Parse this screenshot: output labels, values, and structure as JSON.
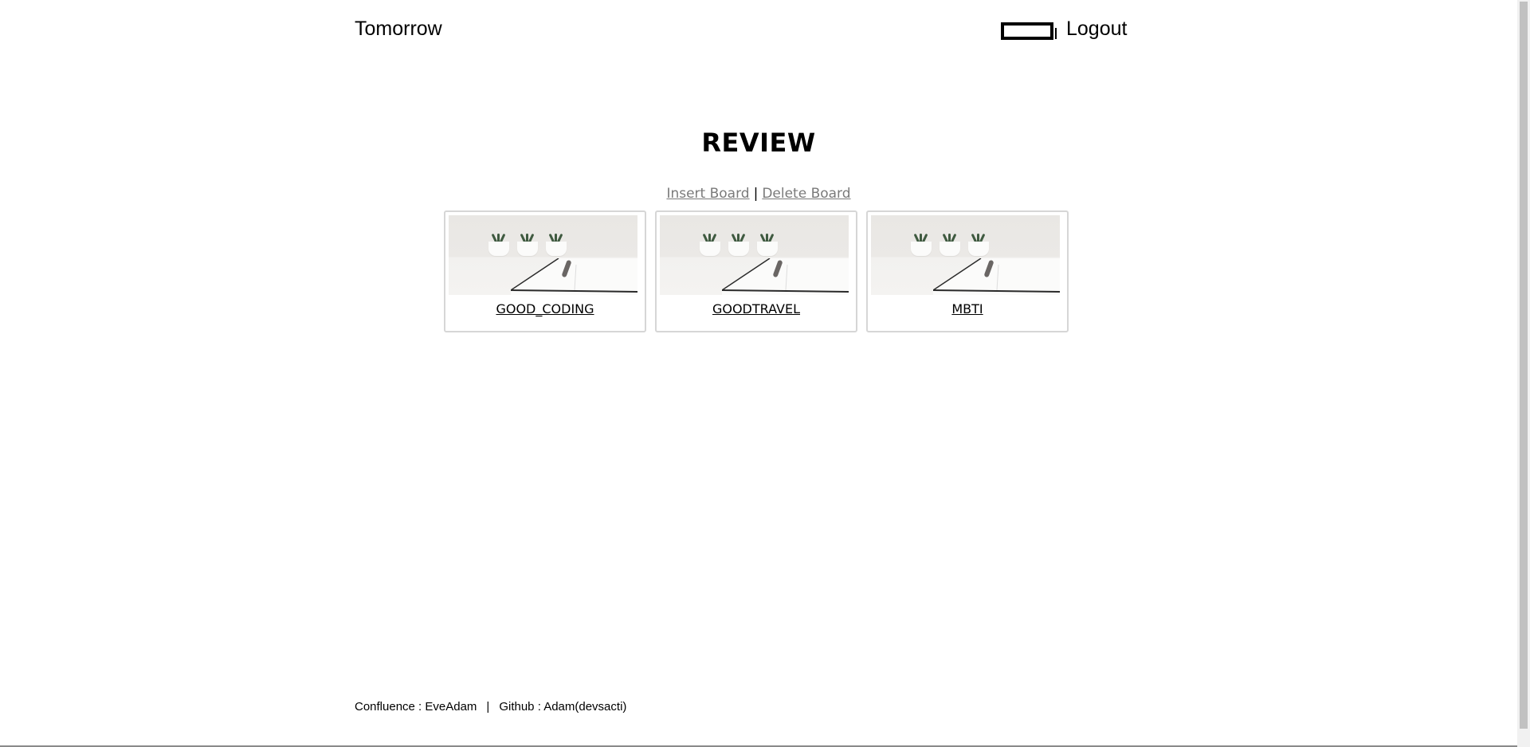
{
  "header": {
    "brand": "Tomorrow",
    "icon": "rectangle-icon",
    "logout_label": "Logout"
  },
  "main": {
    "title": "REVIEW",
    "actions": {
      "insert_label": "Insert Board",
      "separator": "|",
      "delete_label": "Delete Board"
    },
    "boards": [
      {
        "label": "GOOD_CODING",
        "image": "desk-notebook-plants-image"
      },
      {
        "label": "GOODTRAVEL",
        "image": "desk-notebook-plants-image"
      },
      {
        "label": "MBTI",
        "image": "desk-notebook-plants-image"
      }
    ]
  },
  "footer": {
    "confluence": "Confluence : EveAdam",
    "divider": "|",
    "github": "Github : Adam(devsacti)"
  },
  "colors": {
    "link_muted": "#7a7a7a",
    "card_border": "#d6d6d6",
    "text": "#000000"
  }
}
